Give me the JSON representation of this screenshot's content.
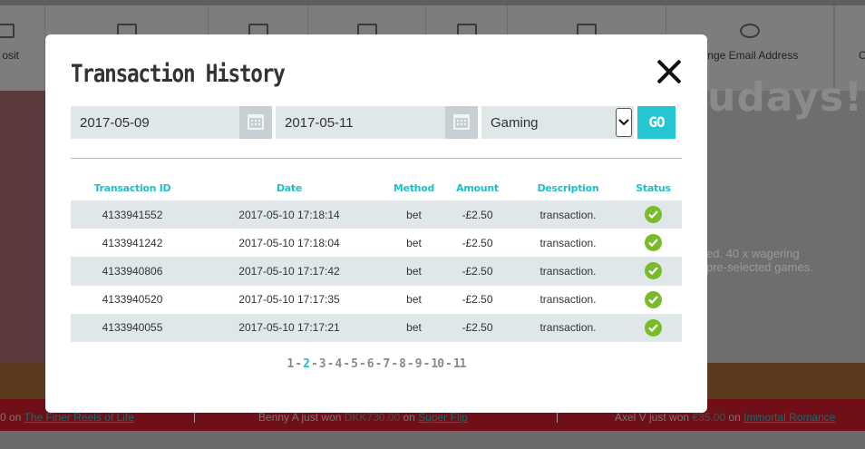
{
  "background": {
    "nav_items": [
      "osit",
      "",
      "",
      "",
      "",
      "",
      "",
      "ange Email Address",
      "C"
    ],
    "headline": "udays!",
    "terms_line1": "ed. 40 x wagering",
    "terms_line2": "pre-selected games.",
    "ticker": [
      {
        "prefix": "0",
        "on": " on ",
        "game": "The Finer Reels of Life"
      },
      {
        "player": "Benny A just won ",
        "amount": "DKK730.00",
        "on": " on ",
        "game": "Super Flip"
      },
      {
        "player": "Axel V just won ",
        "amount": "€35.00",
        "on": " on ",
        "game": "Immortal Romance"
      }
    ]
  },
  "modal": {
    "title": "Transaction History",
    "filters": {
      "from_date": "2017-05-09",
      "to_date": "2017-05-11",
      "type": "Gaming",
      "go_label": "GO"
    },
    "table": {
      "headers": [
        "Transaction ID",
        "Date",
        "Method",
        "Amount",
        "Description",
        "Status"
      ],
      "rows": [
        {
          "id": "4133941552",
          "date": "2017-05-10 17:18:14",
          "method": "bet",
          "amount": "-£2.50",
          "description": "transaction.",
          "status": "success"
        },
        {
          "id": "4133941242",
          "date": "2017-05-10 17:18:04",
          "method": "bet",
          "amount": "-£2.50",
          "description": "transaction.",
          "status": "success"
        },
        {
          "id": "4133940806",
          "date": "2017-05-10 17:17:42",
          "method": "bet",
          "amount": "-£2.50",
          "description": "transaction.",
          "status": "success"
        },
        {
          "id": "4133940520",
          "date": "2017-05-10 17:17:35",
          "method": "bet",
          "amount": "-£2.50",
          "description": "transaction.",
          "status": "success"
        },
        {
          "id": "4133940055",
          "date": "2017-05-10 17:17:21",
          "method": "bet",
          "amount": "-£2.50",
          "description": "transaction.",
          "status": "success"
        }
      ]
    },
    "pagination": {
      "pages": [
        "1",
        "2",
        "3",
        "4",
        "5",
        "6",
        "7",
        "8",
        "9",
        "10",
        "11"
      ],
      "current": "2",
      "separator": "-"
    }
  },
  "colors": {
    "accent": "#25c6d4",
    "success": "#79bb28",
    "row_stripe": "#dfe7e9"
  },
  "icons": {
    "close": "close-icon",
    "calendar": "calendar-icon",
    "dropdown": "chevron-down-icon",
    "status": "check-circle-icon"
  }
}
